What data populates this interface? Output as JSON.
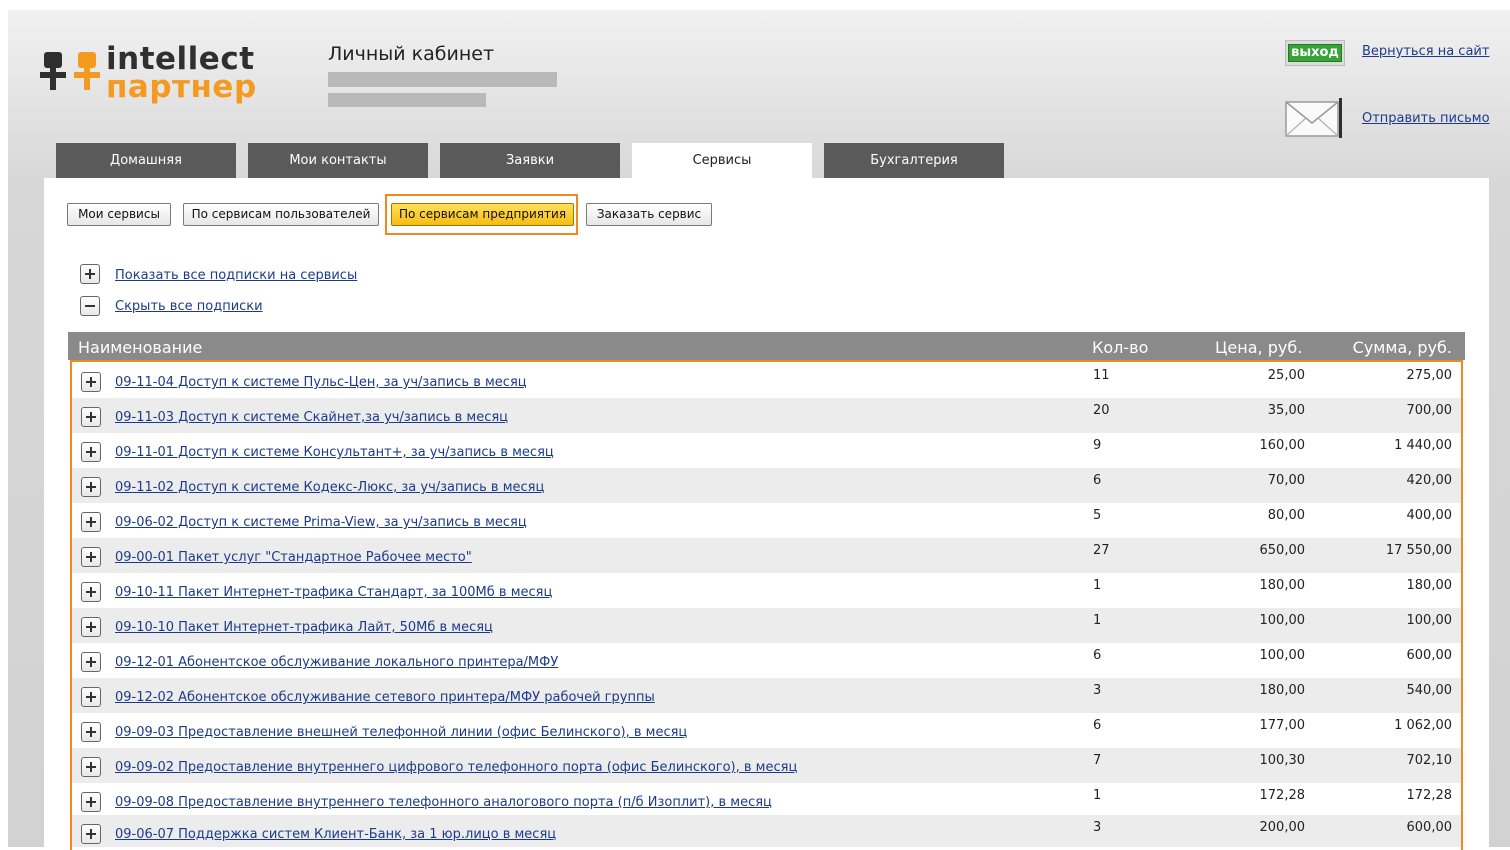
{
  "logo": {
    "line1": "intellect",
    "line2": "партнер"
  },
  "header": {
    "title": "Личный кабинет"
  },
  "top_actions": {
    "exit_label": "выход",
    "back_link": "Вернуться на сайт",
    "send_mail_link": "Отправить письмо"
  },
  "tabs": [
    {
      "label": "Домашняя"
    },
    {
      "label": "Мои контакты"
    },
    {
      "label": "Заявки"
    },
    {
      "label": "Сервисы",
      "active": true
    },
    {
      "label": "Бухгалтерия"
    }
  ],
  "subnav": [
    {
      "label": "Мои сервисы"
    },
    {
      "label": "По сервисам пользователей"
    },
    {
      "label": "По сервисам предприятия",
      "active": true
    },
    {
      "label": "Заказать сервис"
    }
  ],
  "toggles": {
    "show_all": "Показать все подписки на сервисы",
    "hide_all": "Скрыть все подписки"
  },
  "table": {
    "columns": [
      "Наименование",
      "Кол-во",
      "Цена, руб.",
      "Сумма, руб."
    ],
    "rows": [
      {
        "name": "09-11-04 Доступ к системе Пульс-Цен, за уч/запись в месяц",
        "qty": "11",
        "price": "25,00",
        "sum": "275,00"
      },
      {
        "name": "09-11-03 Доступ к системе Скайнет,за уч/запись в месяц",
        "qty": "20",
        "price": "35,00",
        "sum": "700,00"
      },
      {
        "name": "09-11-01 Доступ к системе Консультант+, за уч/запись в месяц",
        "qty": "9",
        "price": "160,00",
        "sum": "1 440,00"
      },
      {
        "name": "09-11-02 Доступ к системе Кодекс-Люкс, за уч/запись в месяц",
        "qty": "6",
        "price": "70,00",
        "sum": "420,00"
      },
      {
        "name": "09-06-02 Доступ к системе Prima-View, за уч/запись в месяц",
        "qty": "5",
        "price": "80,00",
        "sum": "400,00"
      },
      {
        "name": "09-00-01 Пакет услуг \"Стандартное Рабочее место\"",
        "qty": "27",
        "price": "650,00",
        "sum": "17 550,00"
      },
      {
        "name": "09-10-11 Пакет Интернет-трафика Стандарт, за 100Мб в месяц",
        "qty": "1",
        "price": "180,00",
        "sum": "180,00"
      },
      {
        "name": "09-10-10 Пакет Интернет-трафика Лайт, 50Мб в месяц",
        "qty": "1",
        "price": "100,00",
        "sum": "100,00"
      },
      {
        "name": "09-12-01 Абонентское обслуживание локального принтера/МФУ",
        "qty": "6",
        "price": "100,00",
        "sum": "600,00"
      },
      {
        "name": "09-12-02 Абонентское обслуживание сетевого принтера/МФУ рабочей группы",
        "qty": "3",
        "price": "180,00",
        "sum": "540,00"
      },
      {
        "name": "09-09-03 Предоставление внешней телефонной линии (офис Белинского), в месяц",
        "qty": "6",
        "price": "177,00",
        "sum": "1 062,00"
      },
      {
        "name": "09-09-02 Предоставление внутреннего цифрового телефонного порта (офис Белинского), в месяц",
        "qty": "7",
        "price": "100,30",
        "sum": "702,10"
      },
      {
        "name": "09-09-08 Предоставление внутреннего телефонного аналогового порта (п/б Изоплит), в месяц",
        "qty": "1",
        "price": "172,28",
        "sum": "172,28"
      },
      {
        "name": "09-06-07 Поддержка систем Клиент-Банк, за 1 юр.лицо в месяц",
        "qty": "3",
        "price": "200,00",
        "sum": "600,00"
      }
    ]
  },
  "colors": {
    "accent_orange": "#f1891f",
    "tab_dark": "#5a5a5a",
    "link_blue": "#1b3b8a",
    "exit_green": "#3aa338"
  }
}
